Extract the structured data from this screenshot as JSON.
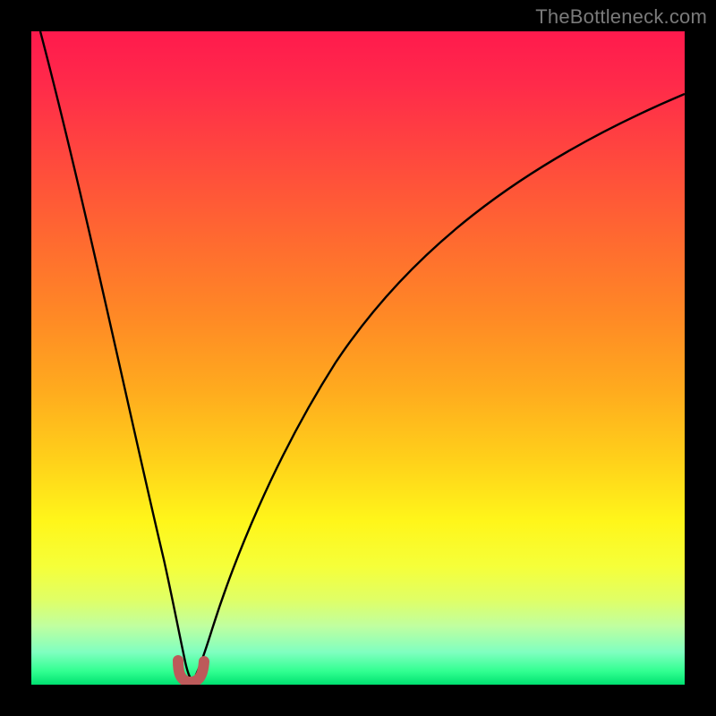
{
  "watermark": "TheBottleneck.com",
  "colors": {
    "frame": "#000000",
    "gradient_top": "#ff1a4d",
    "gradient_bottom": "#00e070",
    "curve": "#000000",
    "marker": "#bd5a5a"
  },
  "chart_data": {
    "type": "line",
    "title": "",
    "xlabel": "",
    "ylabel": "",
    "xlim": [
      0,
      100
    ],
    "ylim": [
      0,
      100
    ],
    "grid": false,
    "legend": false,
    "series": [
      {
        "name": "bottleneck-curve",
        "x": [
          0,
          2,
          5,
          8,
          11,
          14,
          17,
          19,
          20.5,
          22,
          23,
          24,
          25,
          27,
          29,
          31,
          34,
          38,
          43,
          50,
          58,
          68,
          80,
          92,
          100
        ],
        "y": [
          100,
          92,
          80,
          68,
          56,
          44,
          32,
          20,
          10,
          3,
          0.5,
          0,
          0.5,
          4,
          10,
          17,
          27,
          38,
          48,
          58,
          66,
          74,
          81,
          87,
          91
        ]
      }
    ],
    "annotations": [
      {
        "name": "minimum-marker",
        "shape": "u",
        "x_range": [
          22.2,
          25.8
        ],
        "y_range": [
          0,
          3.5
        ]
      }
    ]
  }
}
